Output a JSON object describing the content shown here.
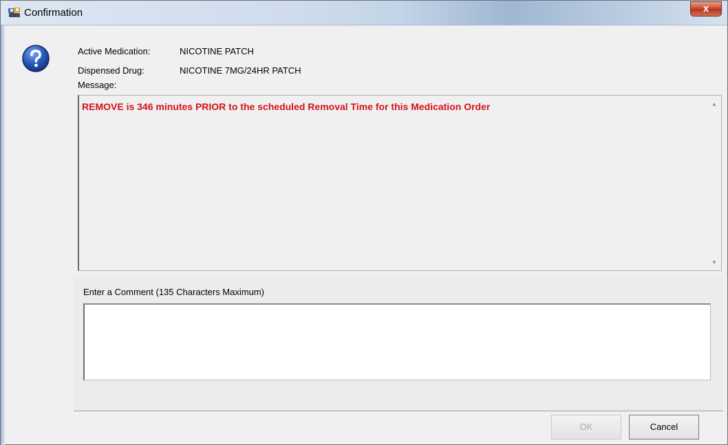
{
  "window": {
    "title": "Confirmation",
    "close_label": "x"
  },
  "details": {
    "active_medication_label": "Active Medication:",
    "active_medication_value": "NICOTINE PATCH",
    "dispensed_drug_label": "Dispensed Drug:",
    "dispensed_drug_value": "NICOTINE 7MG/24HR PATCH",
    "message_label": "Message:"
  },
  "message": {
    "text": "REMOVE is 346 minutes PRIOR to the scheduled Removal Time for this Medication Order",
    "color": "#d4111a"
  },
  "comment": {
    "label": "Enter a Comment  (135 Characters Maximum)",
    "value": ""
  },
  "buttons": {
    "ok_label": "OK",
    "cancel_label": "Cancel"
  },
  "icons": {
    "title_icon": "users-icon",
    "help_icon": "question-icon",
    "scroll_up": "up-arrow-icon",
    "scroll_down": "down-arrow-icon"
  }
}
